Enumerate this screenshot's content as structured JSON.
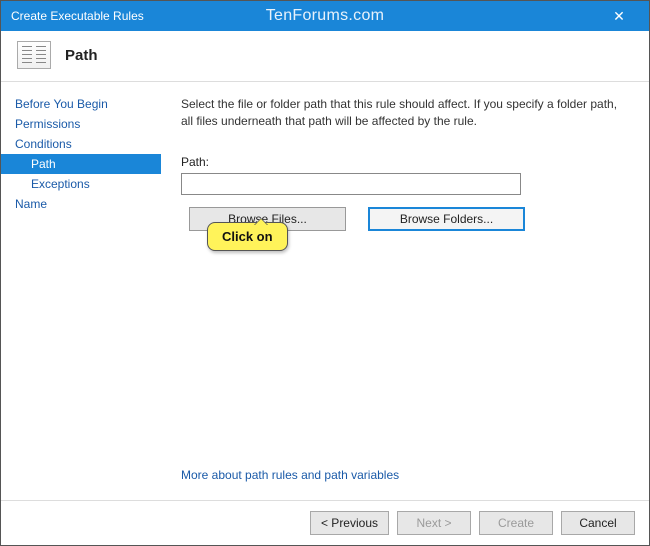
{
  "window": {
    "title": "Create Executable Rules",
    "watermark": "TenForums.com"
  },
  "header": {
    "step_title": "Path"
  },
  "sidebar": {
    "items": [
      {
        "label": "Before You Begin",
        "type": "step"
      },
      {
        "label": "Permissions",
        "type": "step"
      },
      {
        "label": "Conditions",
        "type": "step"
      },
      {
        "label": "Path",
        "type": "sub",
        "selected": true
      },
      {
        "label": "Exceptions",
        "type": "sub"
      },
      {
        "label": "Name",
        "type": "step"
      }
    ]
  },
  "content": {
    "description": "Select the file or folder path that this rule should affect. If you specify a folder path, all files underneath that path will be affected by the rule.",
    "path_label": "Path:",
    "path_value": "",
    "browse_files_label": "Browse Files...",
    "browse_folders_label": "Browse Folders...",
    "more_link": "More about path rules and path variables"
  },
  "callout": {
    "text": "Click on"
  },
  "footer": {
    "previous": "< Previous",
    "next": "Next >",
    "create": "Create",
    "cancel": "Cancel"
  }
}
